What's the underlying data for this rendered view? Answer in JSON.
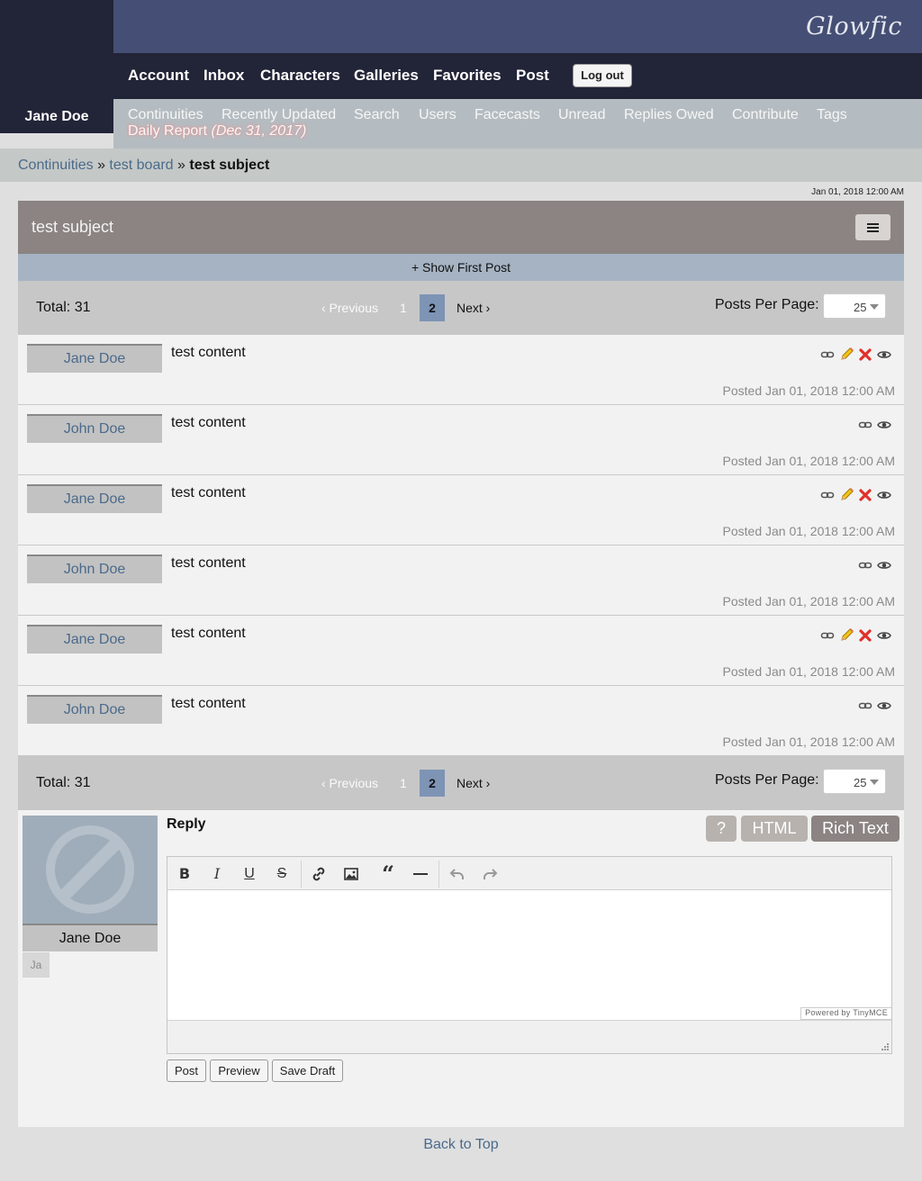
{
  "header": {
    "logo": "Glowfic",
    "nav": [
      "Account",
      "Inbox",
      "Characters",
      "Galleries",
      "Favorites",
      "Post"
    ],
    "logout_label": "Log out",
    "username": "Jane Doe",
    "subnav": [
      "Continuities",
      "Recently Updated",
      "Search",
      "Users",
      "Facecasts",
      "Unread",
      "Replies Owed",
      "Contribute",
      "Tags"
    ],
    "daily_report": "Daily Report",
    "daily_report_date": "(Dec 31, 2017)"
  },
  "breadcrumb": {
    "items": [
      "Continuities",
      "test board"
    ],
    "separator": "»",
    "current": "test subject"
  },
  "timestamp": "Jan 01, 2018 12:00 AM",
  "post": {
    "title": "test subject",
    "show_first": "+ Show First Post"
  },
  "pagination": {
    "total": "Total: 31",
    "prev": "‹ Previous",
    "page1": "1",
    "page2": "2",
    "next": "Next ›",
    "per_page_label": "Posts Per Page:",
    "per_page_value": "25"
  },
  "replies": [
    {
      "author": "Jane Doe",
      "content": "test content",
      "posted": "Posted Jan 01, 2018 12:00 AM",
      "icons": [
        "link-icon",
        "edit-icon",
        "delete-icon",
        "view-icon"
      ]
    },
    {
      "author": "John Doe",
      "content": "test content",
      "posted": "Posted Jan 01, 2018 12:00 AM",
      "icons": [
        "link-icon",
        "view-icon"
      ]
    },
    {
      "author": "Jane Doe",
      "content": "test content",
      "posted": "Posted Jan 01, 2018 12:00 AM",
      "icons": [
        "link-icon",
        "edit-icon",
        "delete-icon",
        "view-icon"
      ]
    },
    {
      "author": "John Doe",
      "content": "test content",
      "posted": "Posted Jan 01, 2018 12:00 AM",
      "icons": [
        "link-icon",
        "view-icon"
      ]
    },
    {
      "author": "Jane Doe",
      "content": "test content",
      "posted": "Posted Jan 01, 2018 12:00 AM",
      "icons": [
        "link-icon",
        "edit-icon",
        "delete-icon",
        "view-icon"
      ]
    },
    {
      "author": "John Doe",
      "content": "test content",
      "posted": "Posted Jan 01, 2018 12:00 AM",
      "icons": [
        "link-icon",
        "view-icon"
      ]
    }
  ],
  "reply_form": {
    "label": "Reply",
    "character_name": "Jane Doe",
    "character_abbrev": "Ja",
    "help_label": "?",
    "html_label": "HTML",
    "rich_label": "Rich Text",
    "toolbar": [
      "bold-icon",
      "italic-icon",
      "underline-icon",
      "strikethrough-icon",
      "link-icon",
      "image-icon",
      "blockquote-icon",
      "horizontal-rule-icon",
      "undo-icon",
      "redo-icon"
    ],
    "powered_by": "Powered by TinyMCE",
    "post_label": "Post",
    "preview_label": "Preview",
    "draft_label": "Save Draft"
  },
  "footer": {
    "back_to_top": "Back to Top"
  },
  "colors": {
    "header_dark": "#222437",
    "header_blue": "#454f75",
    "title_bar": "#8b8482",
    "active_page": "#7e94b5",
    "link": "#4b6a8b"
  }
}
